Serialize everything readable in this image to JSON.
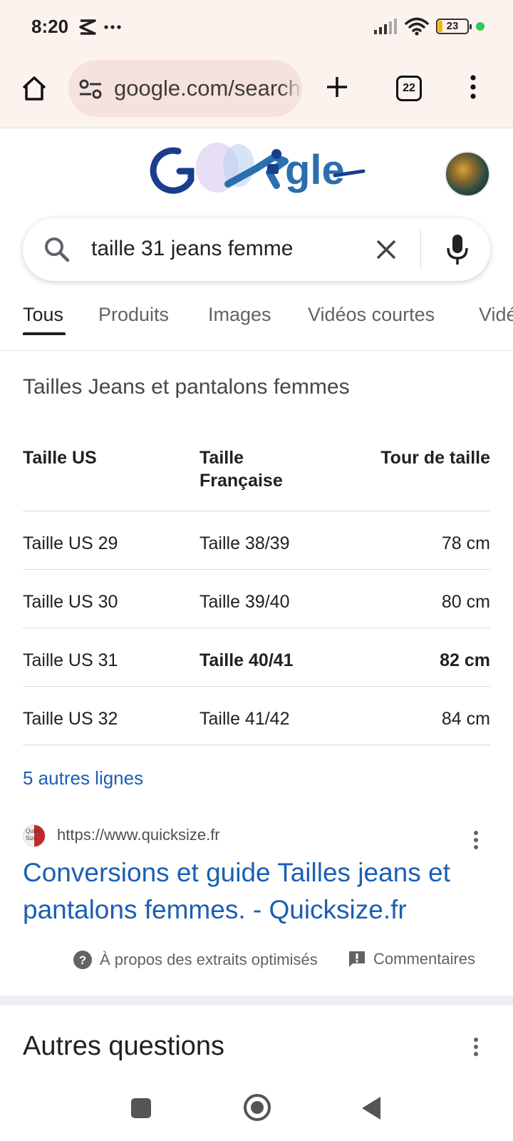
{
  "status_bar": {
    "time": "8:20",
    "battery_level": "23",
    "icons": [
      "notification-icon",
      "more-notifications-icon",
      "signal-icon",
      "wifi-icon",
      "battery-icon",
      "privacy-dot-icon"
    ]
  },
  "browser": {
    "url": "google.com/search",
    "tab_count": "22",
    "colors": {
      "toolbar_bg": "#fcf3ee",
      "urlbar_bg": "#f6e2dd"
    }
  },
  "search": {
    "query": "taille 31 jeans femme",
    "tabs": [
      {
        "label": "Tous",
        "active": true
      },
      {
        "label": "Produits",
        "active": false
      },
      {
        "label": "Images",
        "active": false
      },
      {
        "label": "Vidéos courtes",
        "active": false
      },
      {
        "label": "Vidéos",
        "active": false
      }
    ]
  },
  "snippet": {
    "title": "Tailles Jeans et pantalons femmes",
    "table": {
      "headers": [
        "Taille US",
        "Taille Française",
        "Tour de taille"
      ],
      "rows": [
        [
          "Taille US 29",
          "Taille 38/39",
          "78 cm"
        ],
        [
          "Taille US 30",
          "Taille 39/40",
          "80 cm"
        ],
        [
          "Taille US 31",
          "Taille 40/41",
          "82 cm"
        ],
        [
          "Taille US 32",
          "Taille 41/42",
          "84 cm"
        ]
      ],
      "highlighted_row": 2
    },
    "more_lines": "5 autres lignes",
    "source": {
      "url": "https://www.quicksize.fr",
      "favicon_text": "Quick Size",
      "title": "Conversions et guide Tailles jeans et pantalons femmes. - Quicksize.fr"
    },
    "footer": {
      "about": "À propos des extraits optimisés",
      "feedback": "Commentaires"
    }
  },
  "other_questions": {
    "title": "Autres questions"
  },
  "colors": {
    "link": "#1a5fb4",
    "text": "#202124",
    "muted": "#5f6368"
  }
}
